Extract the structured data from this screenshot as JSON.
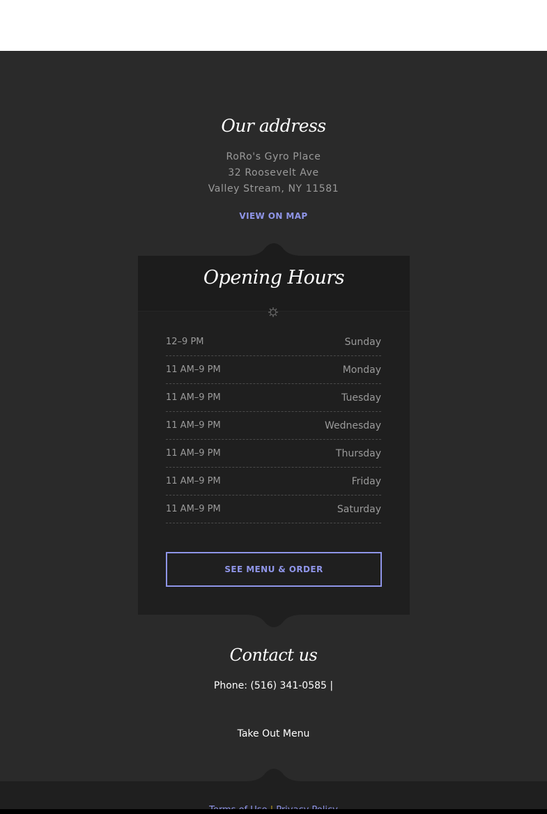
{
  "address": {
    "title": "Our address",
    "name": "RoRo's Gyro Place",
    "street": "32 Roosevelt Ave",
    "city": "Valley Stream, NY 11581",
    "map_link": "VIEW ON MAP"
  },
  "hours": {
    "title": "Opening Hours",
    "rows": [
      {
        "time": "12–9 PM",
        "day": "Sunday"
      },
      {
        "time": "11 AM–9 PM",
        "day": "Monday"
      },
      {
        "time": "11 AM–9 PM",
        "day": "Tuesday"
      },
      {
        "time": "11 AM–9 PM",
        "day": "Wednesday"
      },
      {
        "time": "11 AM–9 PM",
        "day": "Thursday"
      },
      {
        "time": "11 AM–9 PM",
        "day": "Friday"
      },
      {
        "time": "11 AM–9 PM",
        "day": "Saturday"
      }
    ],
    "menu_button": "SEE MENU & ORDER"
  },
  "contact": {
    "title": "Contact us",
    "phone": "Phone: (516) 341-0585 |",
    "takeout": "Take Out Menu"
  },
  "footer": {
    "terms": "Terms of Use",
    "separator": "|",
    "privacy": "Privacy Policy"
  },
  "colors": {
    "accent": "#8f95e8",
    "background": "#2a2a2a",
    "panel": "#1f1f1f"
  }
}
